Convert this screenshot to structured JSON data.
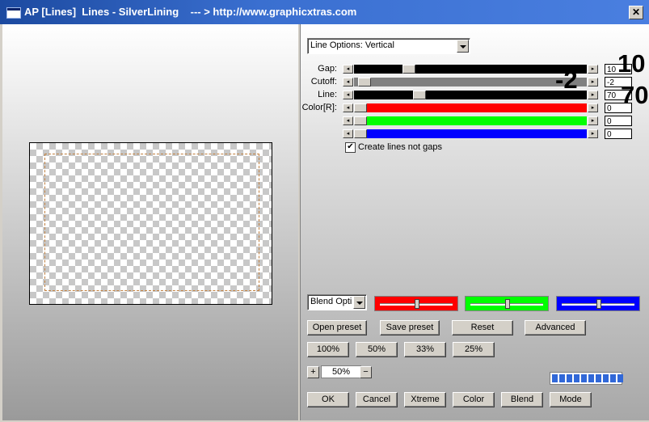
{
  "window": {
    "title": "AP [Lines]  Lines - SilverLining    --- > http://www.graphicxtras.com",
    "close_label": "✕"
  },
  "options": {
    "line_options_selected": "Line Options: Vertical",
    "sliders": [
      {
        "label": "Gap:",
        "value": "10",
        "big": "10",
        "fraction": 0.22,
        "track": "#000000"
      },
      {
        "label": "Cutoff:",
        "value": "-2",
        "big": "-2",
        "fraction": 0.02,
        "track": "#808080"
      },
      {
        "label": "Line:",
        "value": "70",
        "big": "70",
        "fraction": 0.27,
        "track": "#000000"
      },
      {
        "label": "Color[R]:",
        "value": "0",
        "fraction": 0.0,
        "track": "#ff0000"
      },
      {
        "label": "",
        "value": "0",
        "fraction": 0.0,
        "track": "#00ff00"
      },
      {
        "label": "",
        "value": "0",
        "fraction": 0.0,
        "track": "#0000ff"
      }
    ],
    "checkbox_label": "Create lines not gaps",
    "checkbox_checked": true
  },
  "blend": {
    "blend_select": "Blend Opti",
    "swatches": [
      {
        "color": "#ff0000",
        "level": 0.5
      },
      {
        "color": "#00ff00",
        "level": 0.5
      },
      {
        "color": "#0000ff",
        "level": 0.5
      }
    ]
  },
  "buttons": {
    "open_preset": "Open preset",
    "save_preset": "Save preset",
    "reset": "Reset",
    "advanced": "Advanced",
    "z100": "100%",
    "z50": "50%",
    "z33": "33%",
    "z25": "25%",
    "ok": "OK",
    "cancel": "Cancel",
    "xtreme": "Xtreme",
    "color": "Color",
    "blend": "Blend",
    "mode": "Mode",
    "plus": "+",
    "minus": "−"
  },
  "zoom": {
    "value": "50%"
  },
  "progress": {
    "segments_filled": 10,
    "segments_total": 10
  }
}
